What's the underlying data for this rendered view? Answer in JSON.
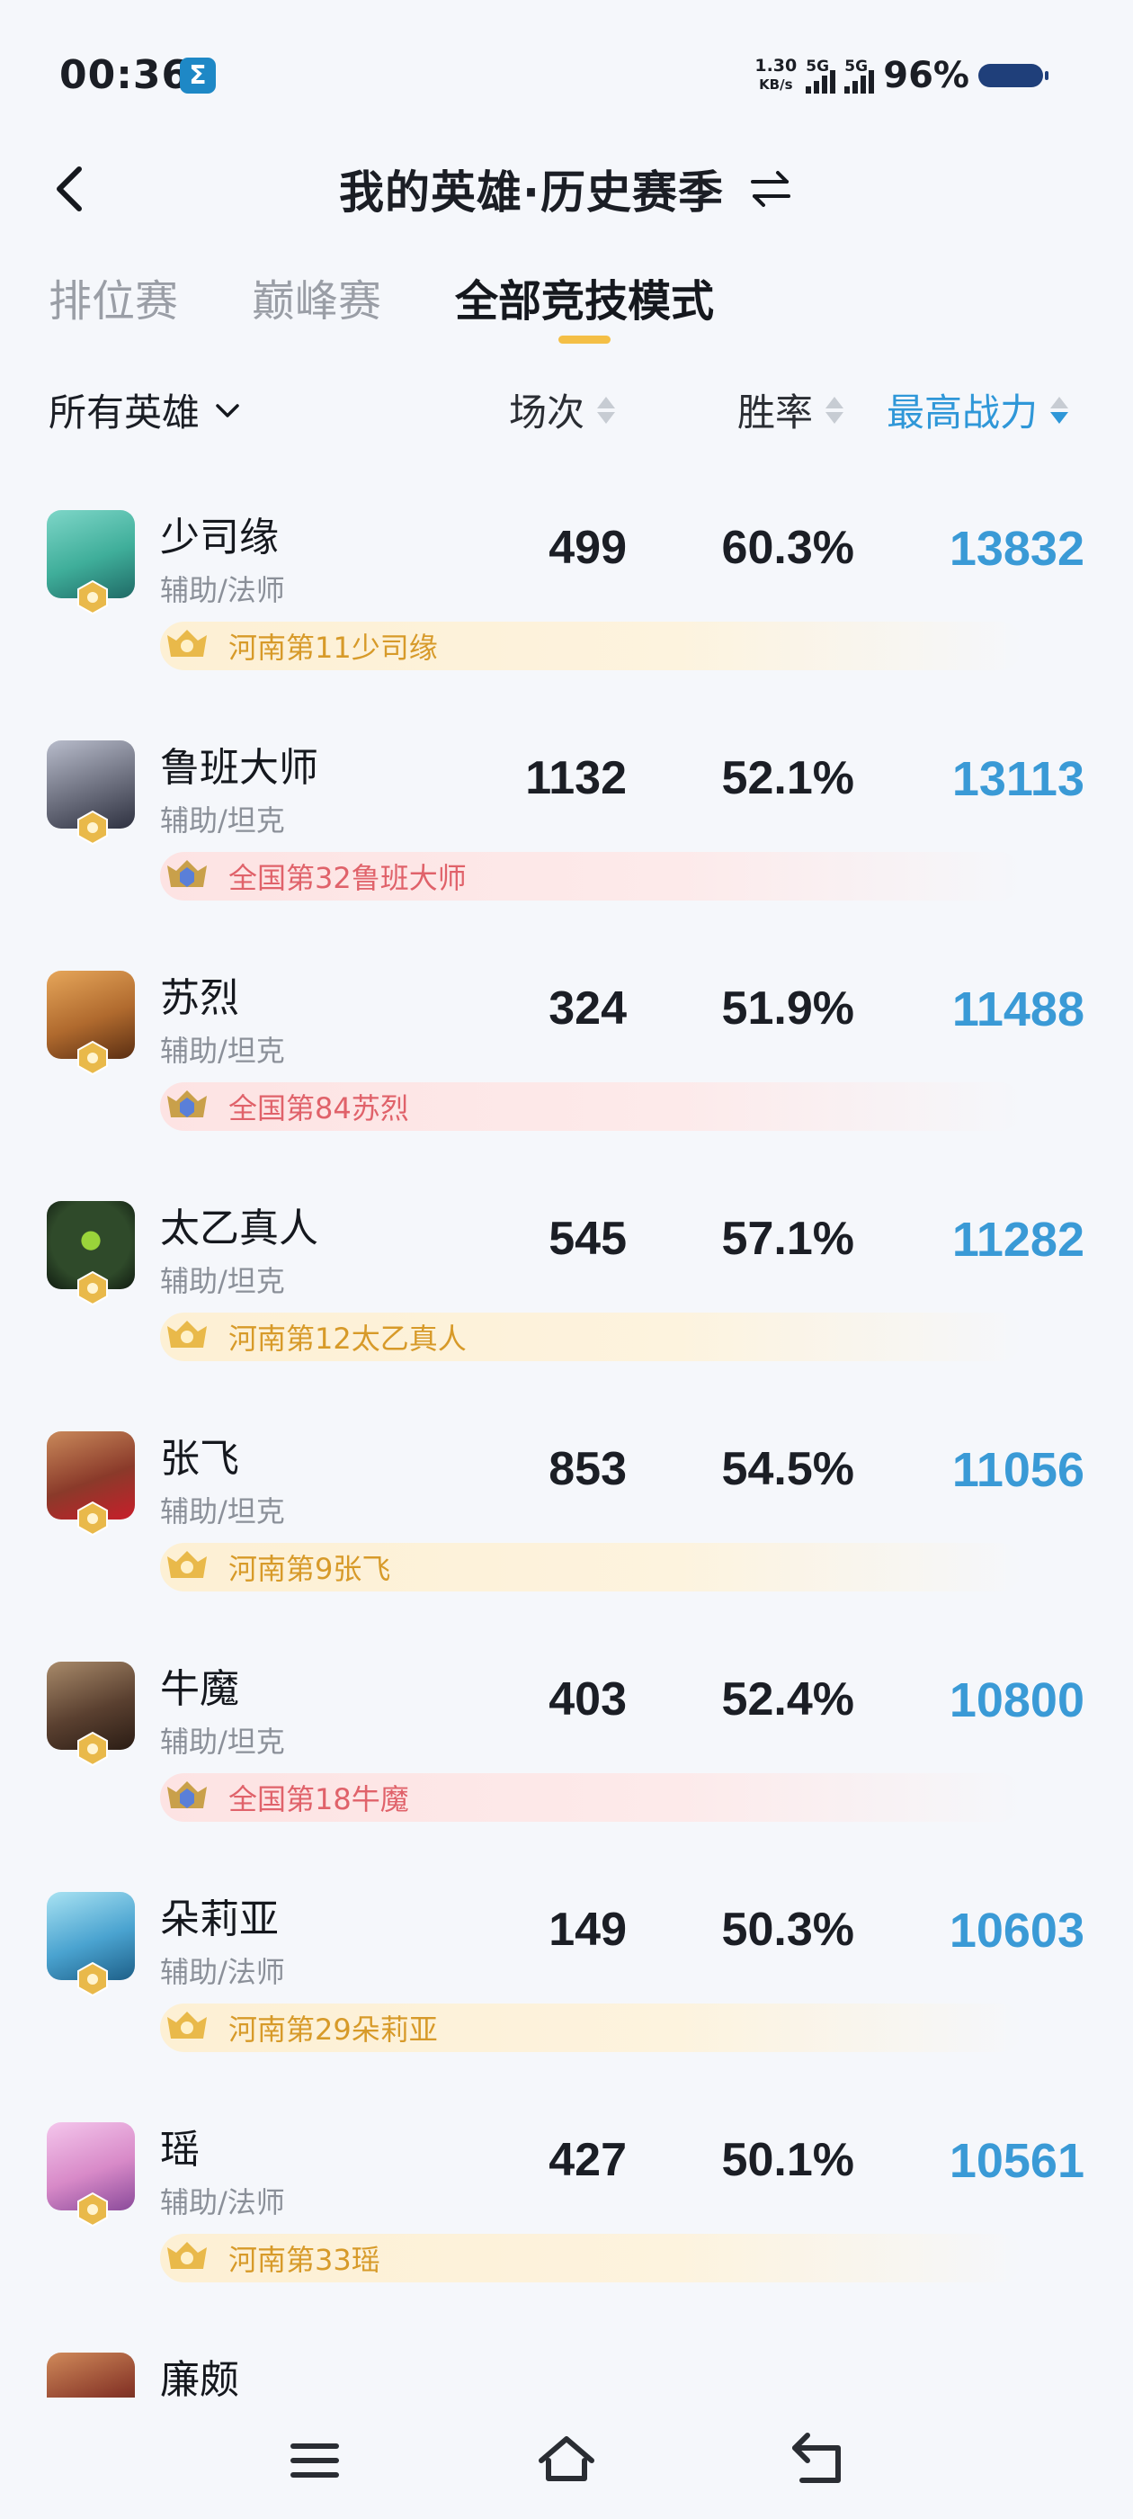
{
  "status_bar": {
    "time": "00:36",
    "app_icon": "Σ",
    "net_speed_value": "1.30",
    "net_speed_unit": "KB/s",
    "signal1_label": "5G",
    "signal2_label": "5G",
    "battery_percent": "96%"
  },
  "header": {
    "title": "我的英雄·历史赛季",
    "back_icon": "back-arrow-icon",
    "switch_icon": "swap-arrows-icon"
  },
  "tabs": [
    {
      "label": "排位赛",
      "active": false
    },
    {
      "label": "巅峰赛",
      "active": false
    },
    {
      "label": "全部竞技模式",
      "active": true
    }
  ],
  "filter": {
    "hero_filter_label": "所有英雄",
    "col_games_label": "场次",
    "col_winrate_label": "胜率",
    "col_power_label": "最高战力",
    "active_sort": "最高战力",
    "accent_color": "#2f97d8"
  },
  "heroes": [
    {
      "name": "少司缘",
      "role": "辅助/法师",
      "games": "499",
      "winrate": "60.3%",
      "power": "13832",
      "rank": "河南第11少司缘",
      "rank_type": "gold",
      "avatar_color": "#3fae9a"
    },
    {
      "name": "鲁班大师",
      "role": "辅助/坦克",
      "games": "1132",
      "winrate": "52.1%",
      "power": "13113",
      "rank": "全国第32鲁班大师",
      "rank_type": "red",
      "avatar_color": "#6c6f7e"
    },
    {
      "name": "苏烈",
      "role": "辅助/坦克",
      "games": "324",
      "winrate": "51.9%",
      "power": "11488",
      "rank": "全国第84苏烈",
      "rank_type": "red",
      "avatar_color": "#b06a2e"
    },
    {
      "name": "太乙真人",
      "role": "辅助/坦克",
      "games": "545",
      "winrate": "57.1%",
      "power": "11282",
      "rank": "河南第12太乙真人",
      "rank_type": "gold",
      "avatar_color": "#2f4a2a"
    },
    {
      "name": "张飞",
      "role": "辅助/坦克",
      "games": "853",
      "winrate": "54.5%",
      "power": "11056",
      "rank": "河南第9张飞",
      "rank_type": "gold",
      "avatar_color": "#8a3a2a"
    },
    {
      "name": "牛魔",
      "role": "辅助/坦克",
      "games": "403",
      "winrate": "52.4%",
      "power": "10800",
      "rank": "全国第18牛魔",
      "rank_type": "red",
      "avatar_color": "#5a4030"
    },
    {
      "name": "朵莉亚",
      "role": "辅助/法师",
      "games": "149",
      "winrate": "50.3%",
      "power": "10603",
      "rank": "河南第29朵莉亚",
      "rank_type": "gold",
      "avatar_color": "#4aa3d0"
    },
    {
      "name": "瑶",
      "role": "辅助/法师",
      "games": "427",
      "winrate": "50.1%",
      "power": "10561",
      "rank": "河南第33瑶",
      "rank_type": "gold",
      "avatar_color": "#d88ac8"
    },
    {
      "name": "廉颇",
      "role": "",
      "games": "",
      "winrate": "",
      "power": "",
      "rank": "",
      "rank_type": "gold",
      "avatar_color": "#8a3a2a"
    }
  ],
  "nav": {
    "menu_icon": "menu-icon",
    "home_icon": "home-icon",
    "back_icon": "back-icon"
  }
}
